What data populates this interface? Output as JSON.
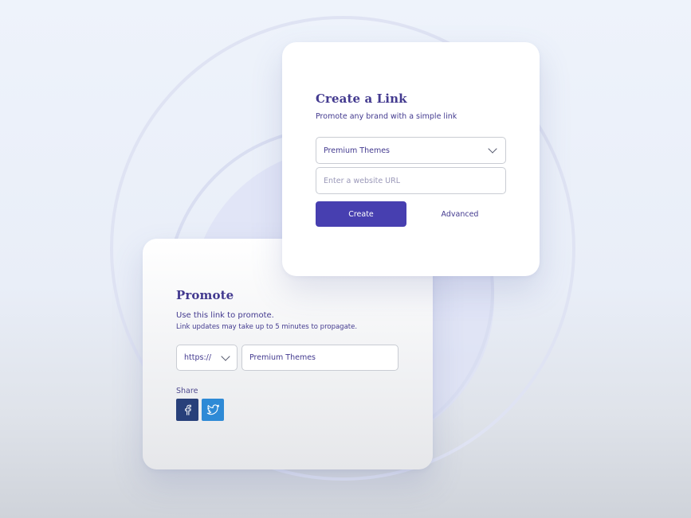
{
  "create_card": {
    "title": "Create a Link",
    "subtitle": "Promote any brand with a simple link",
    "theme_select": {
      "value": "Premium Themes"
    },
    "url_input": {
      "placeholder": "Enter a website URL",
      "value": ""
    },
    "create_label": "Create",
    "advanced_label": "Advanced"
  },
  "promote_card": {
    "title": "Promote",
    "line1": "Use this link to promote.",
    "line2": "Link updates may take up to 5 minutes to propagate.",
    "protocol_select": {
      "value": "https://"
    },
    "link_field": {
      "value": "Premium Themes"
    },
    "share_label": "Share",
    "social": [
      {
        "icon": "facebook-icon",
        "color": "#28407a"
      },
      {
        "icon": "twitter-icon",
        "color": "#2e8ad6"
      }
    ]
  },
  "colors": {
    "accent": "#473fb0",
    "text": "#433a8f"
  }
}
